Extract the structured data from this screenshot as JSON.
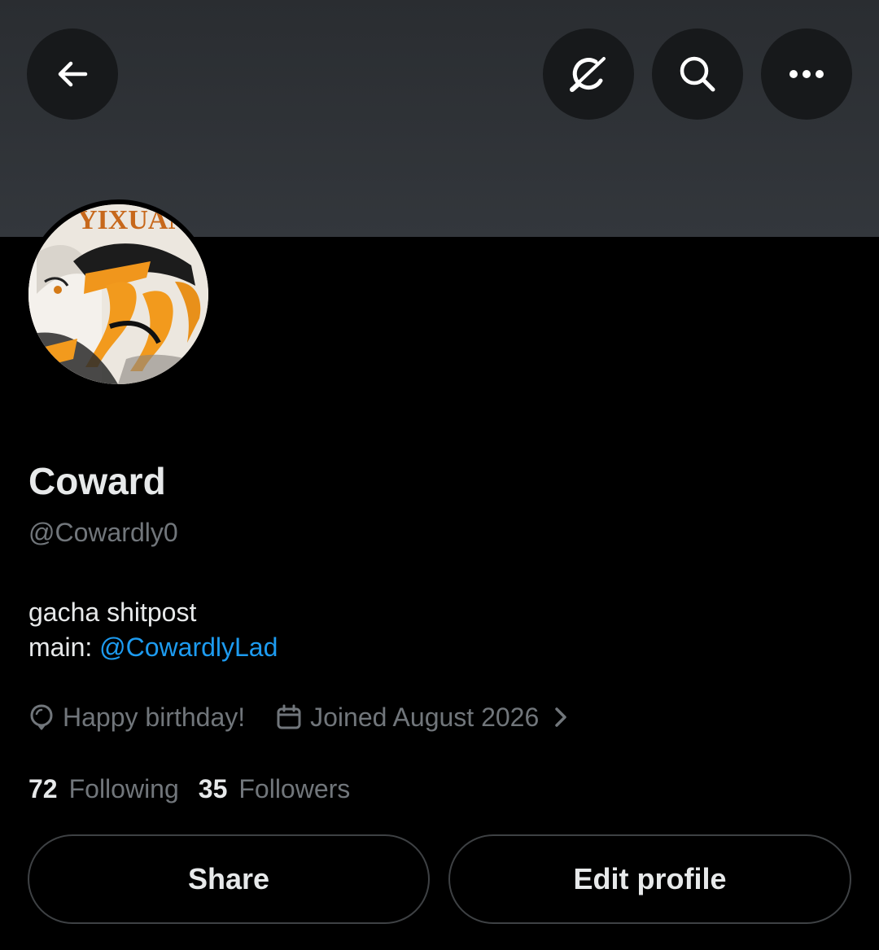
{
  "header": {
    "back_icon": "arrow-left-icon",
    "grok_icon": "grok-icon",
    "search_icon": "search-icon",
    "more_icon": "more-horizontal-icon",
    "banner_color": "#2e3236"
  },
  "profile": {
    "display_name": "Coward",
    "handle": "@Cowardly0",
    "bio_line1": "gacha shitpost",
    "bio_line2_prefix": "main: ",
    "bio_line2_mention": "@CowardlyLad",
    "avatar_text": "YIXUAN",
    "birthday_text": "Happy birthday!",
    "birthday_icon": "balloon-icon",
    "joined_text": "Joined August 2026",
    "joined_icon": "calendar-icon",
    "chevron_icon": "chevron-right-icon"
  },
  "stats": {
    "following_count": "72",
    "following_label": "Following",
    "followers_count": "35",
    "followers_label": "Followers"
  },
  "actions": {
    "share_label": "Share",
    "edit_label": "Edit profile"
  },
  "colors": {
    "accent": "#1d9bf0",
    "muted": "#71767b",
    "text": "#e7e9ea",
    "background": "#000000"
  }
}
